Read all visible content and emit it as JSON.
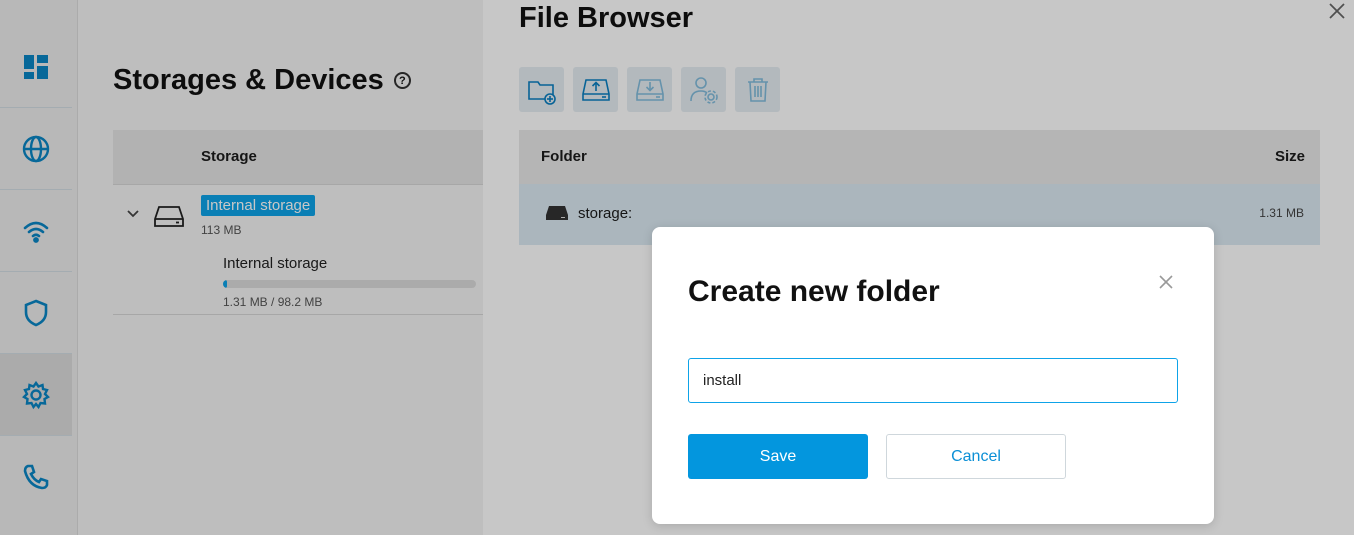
{
  "page": {
    "title": "Storages & Devices",
    "help_icon": "?"
  },
  "sidebar": {
    "items": [
      {
        "icon": "dashboard-icon"
      },
      {
        "icon": "globe-icon"
      },
      {
        "icon": "wifi-icon"
      },
      {
        "icon": "shield-icon"
      },
      {
        "icon": "gear-icon",
        "active": true
      },
      {
        "icon": "phone-icon"
      }
    ]
  },
  "storage_table": {
    "header": "Storage",
    "rows": [
      {
        "name": "Internal storage",
        "size": "113 MB",
        "partitions": [
          {
            "name": "Internal storage",
            "usage": "1.31 MB / 98.2 MB",
            "used_fraction": 0.013
          }
        ]
      }
    ]
  },
  "file_browser": {
    "title": "File Browser",
    "toolbar": [
      {
        "icon": "new-folder-icon",
        "enabled": true
      },
      {
        "icon": "upload-icon",
        "enabled": true
      },
      {
        "icon": "download-icon",
        "enabled": false
      },
      {
        "icon": "permissions-icon",
        "enabled": false
      },
      {
        "icon": "trash-icon",
        "enabled": false
      }
    ],
    "columns": {
      "folder": "Folder",
      "size": "Size"
    },
    "rows": [
      {
        "name": "storage:",
        "size": "1.31 MB"
      }
    ]
  },
  "modal": {
    "title": "Create new folder",
    "input_value": "install",
    "save_label": "Save",
    "cancel_label": "Cancel"
  },
  "colors": {
    "accent": "#0396de",
    "badge": "#0ea3e8",
    "selected_row": "#dbeaf3"
  }
}
